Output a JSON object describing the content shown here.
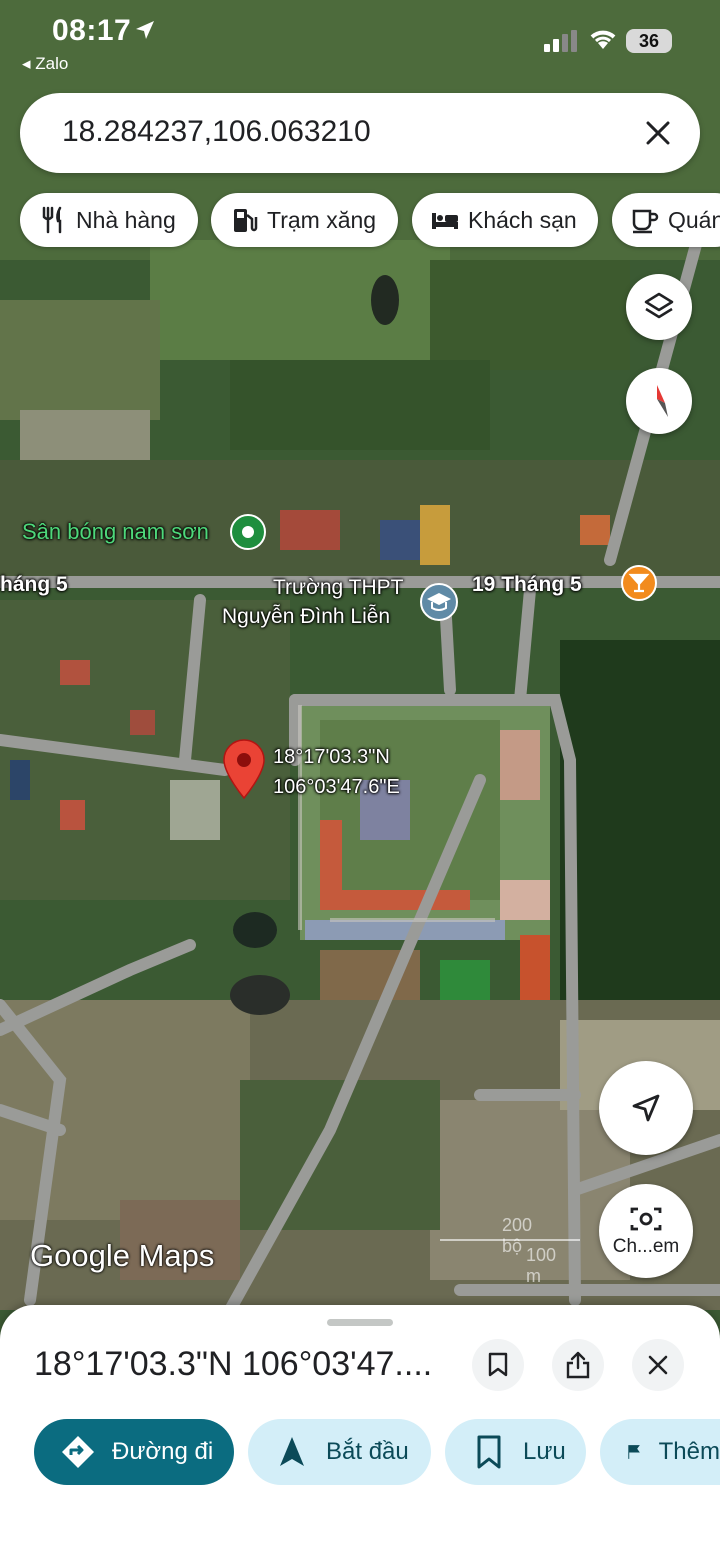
{
  "status_bar": {
    "time": "08:17",
    "back_app": "◂ Zalo",
    "battery": "36"
  },
  "search": {
    "query": "18.284237,106.063210"
  },
  "chips": [
    {
      "label": "Nhà hàng",
      "icon": "fork-knife-icon"
    },
    {
      "label": "Trạm xăng",
      "icon": "gas-station-icon"
    },
    {
      "label": "Khách sạn",
      "icon": "bed-icon"
    },
    {
      "label": "Quán",
      "icon": "coffee-cup-icon"
    }
  ],
  "map": {
    "places": {
      "stadium": "Sân bóng nam sơn",
      "street_left": "háng 5",
      "school_line1": "Trường THPT",
      "school_line2": "Nguyễn Đình Liễn",
      "street_right": "19 Tháng 5"
    },
    "pin": {
      "lat_dms": "18°17'03.3\"N",
      "lng_dms": "106°03'47.6\"E"
    },
    "watermark": "Google Maps",
    "scale_label_ft": "200 bộ",
    "scale_label_m": "100 m",
    "lens_label": "Ch...em"
  },
  "sheet": {
    "title": "18°17'03.3\"N 106°03'47....",
    "actions": [
      {
        "label": "Đường đi",
        "icon": "directions-icon"
      },
      {
        "label": "Bắt đầu",
        "icon": "navigation-arrow-icon"
      },
      {
        "label": "Lưu",
        "icon": "bookmark-icon"
      },
      {
        "label": "Thêm",
        "icon": "flag-icon"
      }
    ]
  },
  "colors": {
    "primary_action": "#0b6c80",
    "secondary_action": "#d3eef8",
    "pin_red": "#ea4335",
    "compass_red": "#e53935"
  }
}
